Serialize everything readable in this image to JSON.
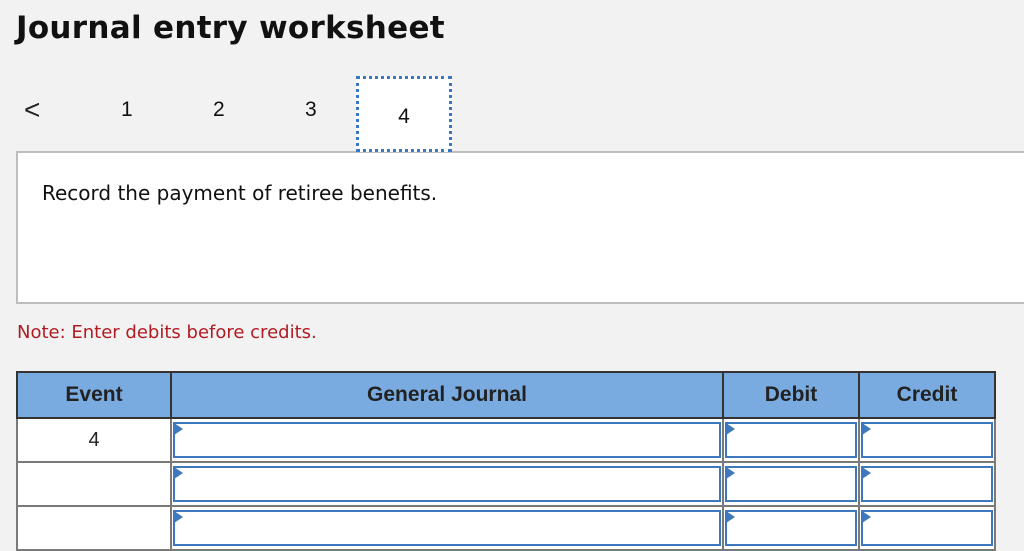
{
  "title": "Journal entry worksheet",
  "nav": {
    "prev_icon": "chevron-left-icon",
    "prev_glyph": "<",
    "tabs": [
      {
        "label": "1",
        "active": false
      },
      {
        "label": "2",
        "active": false
      },
      {
        "label": "3",
        "active": false
      },
      {
        "label": "4",
        "active": true
      }
    ]
  },
  "description": "Record the payment of retiree benefits.",
  "note": "Note: Enter debits before credits.",
  "table": {
    "headers": [
      "Event",
      "General Journal",
      "Debit",
      "Credit"
    ],
    "rows": [
      {
        "event": "4",
        "account": "",
        "debit": "",
        "credit": ""
      },
      {
        "event": "",
        "account": "",
        "debit": "",
        "credit": ""
      },
      {
        "event": "",
        "account": "",
        "debit": "",
        "credit": ""
      }
    ]
  },
  "colors": {
    "header_bg": "#79abe0",
    "input_border": "#3d78bd",
    "note_text": "#b01c22",
    "active_tab_border": "#3b78c4"
  }
}
